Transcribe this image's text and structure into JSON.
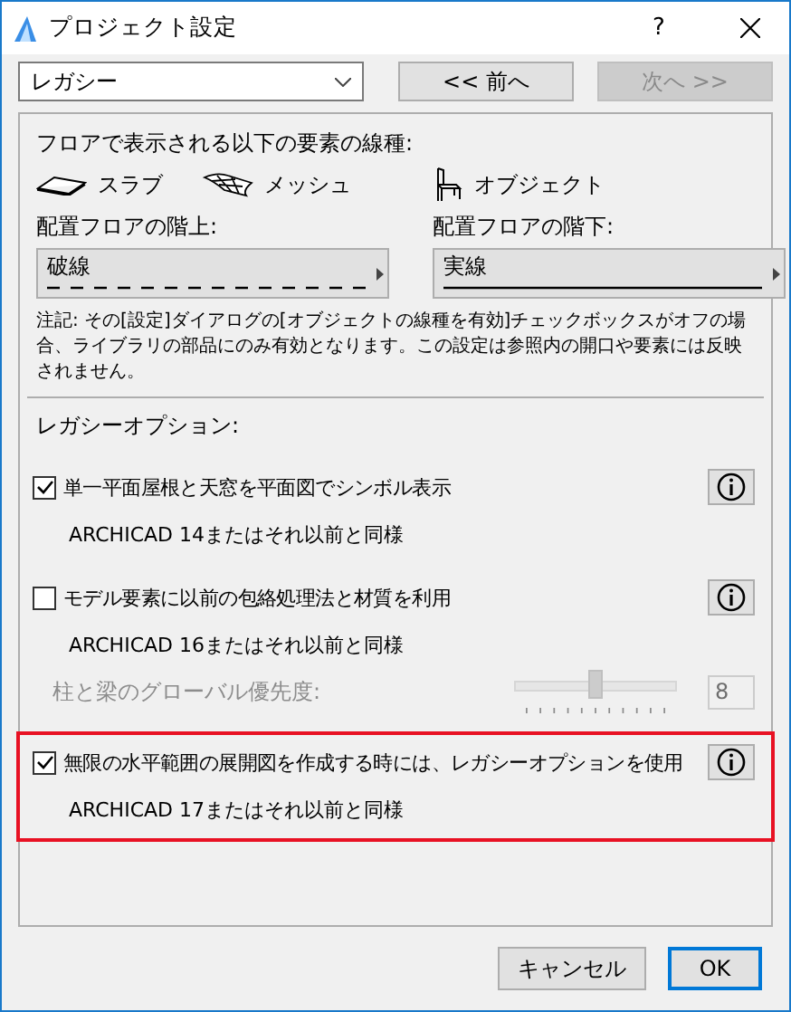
{
  "window": {
    "title": "プロジェクト設定",
    "help": "?"
  },
  "nav": {
    "dropdown": {
      "value": "レガシー"
    },
    "buttons": [
      {
        "label": "<< 前へ",
        "disabled": false
      },
      {
        "label": "次へ >>",
        "disabled": true
      }
    ]
  },
  "line_types": {
    "heading": "フロアで表示される以下の要素の線種:",
    "elements": [
      {
        "kind": "slab",
        "label": "スラブ"
      },
      {
        "kind": "mesh",
        "label": "メッシュ"
      },
      {
        "kind": "object",
        "label": "オブジェクト"
      }
    ],
    "selectors": [
      {
        "label": "配置フロアの階上:",
        "value": "破線",
        "dashed": true
      },
      {
        "label": "配置フロアの階下:",
        "value": "実線",
        "dashed": false
      }
    ],
    "note": "注記: その[設定]ダイアログの[オブジェクトの線種を有効]チェックボックスがオフの場合、ライブラリの部品にのみ有効となります。この設定は参照内の開口や要素には反映されません。"
  },
  "legacy": {
    "heading": "レガシーオプション:",
    "options": [
      {
        "label": "単一平面屋根と天窓を平面図でシンボル表示",
        "checked": true,
        "highlighted": false,
        "sub": "ARCHICAD 14またはそれ以前と同様"
      },
      {
        "label": "モデル要素に以前の包絡処理法と材質を利用",
        "checked": false,
        "highlighted": false,
        "sub": "ARCHICAD 16またはそれ以前と同様",
        "slider": {
          "label": "柱と梁のグローバル優先度:",
          "level": 0.5,
          "value": "8",
          "disabled": true
        }
      },
      {
        "label": "無限の水平範囲の展開図を作成する時には、レガシーオプションを使用",
        "checked": true,
        "highlighted": true,
        "sub": "ARCHICAD 17またはそれ以前と同様"
      }
    ]
  },
  "buttons": [
    {
      "label": "キャンセル",
      "default": false
    },
    {
      "label": "OK",
      "default": true
    }
  ]
}
